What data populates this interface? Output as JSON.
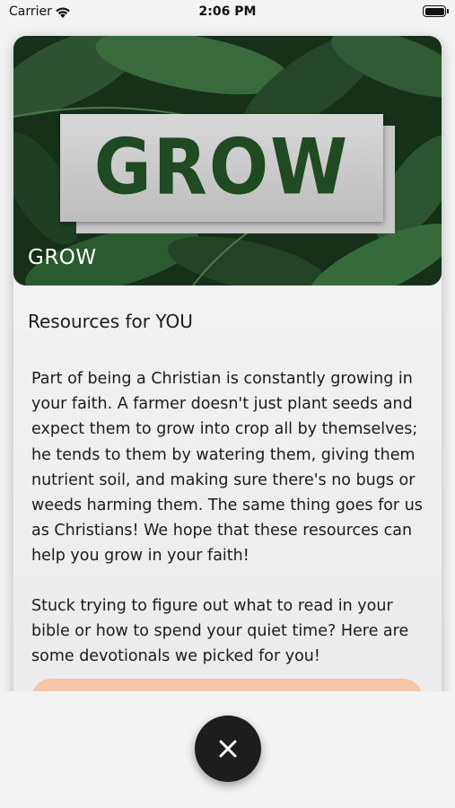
{
  "status_bar": {
    "carrier": "Carrier",
    "time": "2:06 PM"
  },
  "hero": {
    "logo_text": "GROW",
    "title": "GROW"
  },
  "content": {
    "section_title": "Resources for YOU",
    "paragraph1": "Part of being a Christian is constantly growing in your faith. A farmer doesn't just plant seeds and expect them to grow into crop all by themselves; he tends to them by watering them, giving them nutrient soil, and making sure there's no bugs or weeds harming them. The same thing goes for us as Christians! We hope that these resources can help you grow in your faith!",
    "paragraph2": "Stuck trying to figure out what to read in your bible or how to spend your quiet time? Here are some devotionals we picked for you!"
  },
  "colors": {
    "accent_button": "#f7c9a8",
    "close_button": "#1d1d1d",
    "logo_green": "#1f4a22"
  },
  "icons": {
    "close": "close-icon",
    "wifi": "wifi-icon",
    "battery": "battery-icon"
  }
}
